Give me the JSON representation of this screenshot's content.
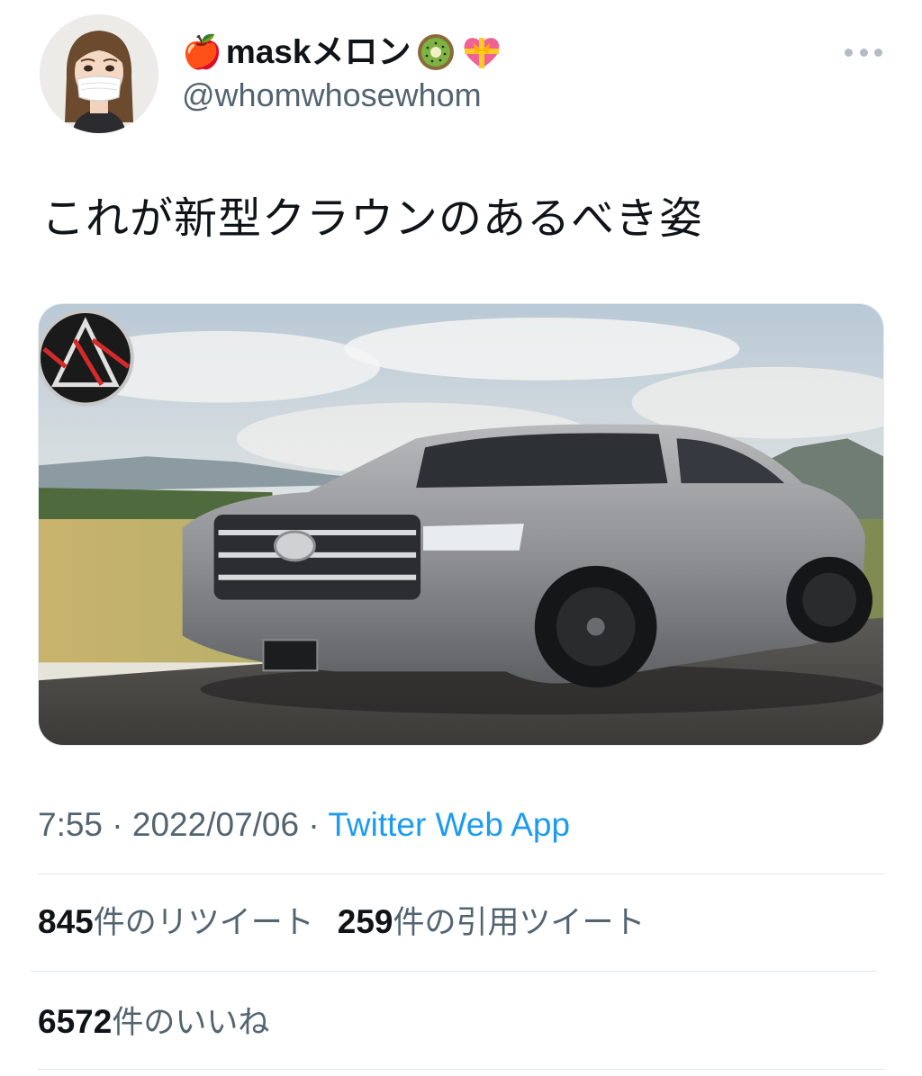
{
  "user": {
    "name_prefix_emoji": "🍎",
    "name": "maskメロン",
    "name_suffix_emojis": [
      "kiwi-emoji",
      "heart-with-ribbon-emoji"
    ],
    "handle": "@whomwhosewhom"
  },
  "tweet": {
    "text": "これが新型クラウンのあるべき姿"
  },
  "meta": {
    "time": "7:55",
    "sep1": " · ",
    "date": "2022/07/06",
    "sep2": " · ",
    "source": "Twitter Web App"
  },
  "stats": {
    "retweets_count": "845",
    "retweets_label": "件のリツイート",
    "quotes_count": "259",
    "quotes_label": "件の引用ツイート",
    "likes_count": "6572",
    "likes_label": "件のいいね"
  },
  "colors": {
    "link": "#1d9bf0",
    "secondary_text": "#536471",
    "primary_text": "#0f1419"
  },
  "icons": [
    "more-icon",
    "avatar",
    "apple-emoji",
    "kiwi-emoji",
    "heart-with-ribbon-emoji"
  ]
}
